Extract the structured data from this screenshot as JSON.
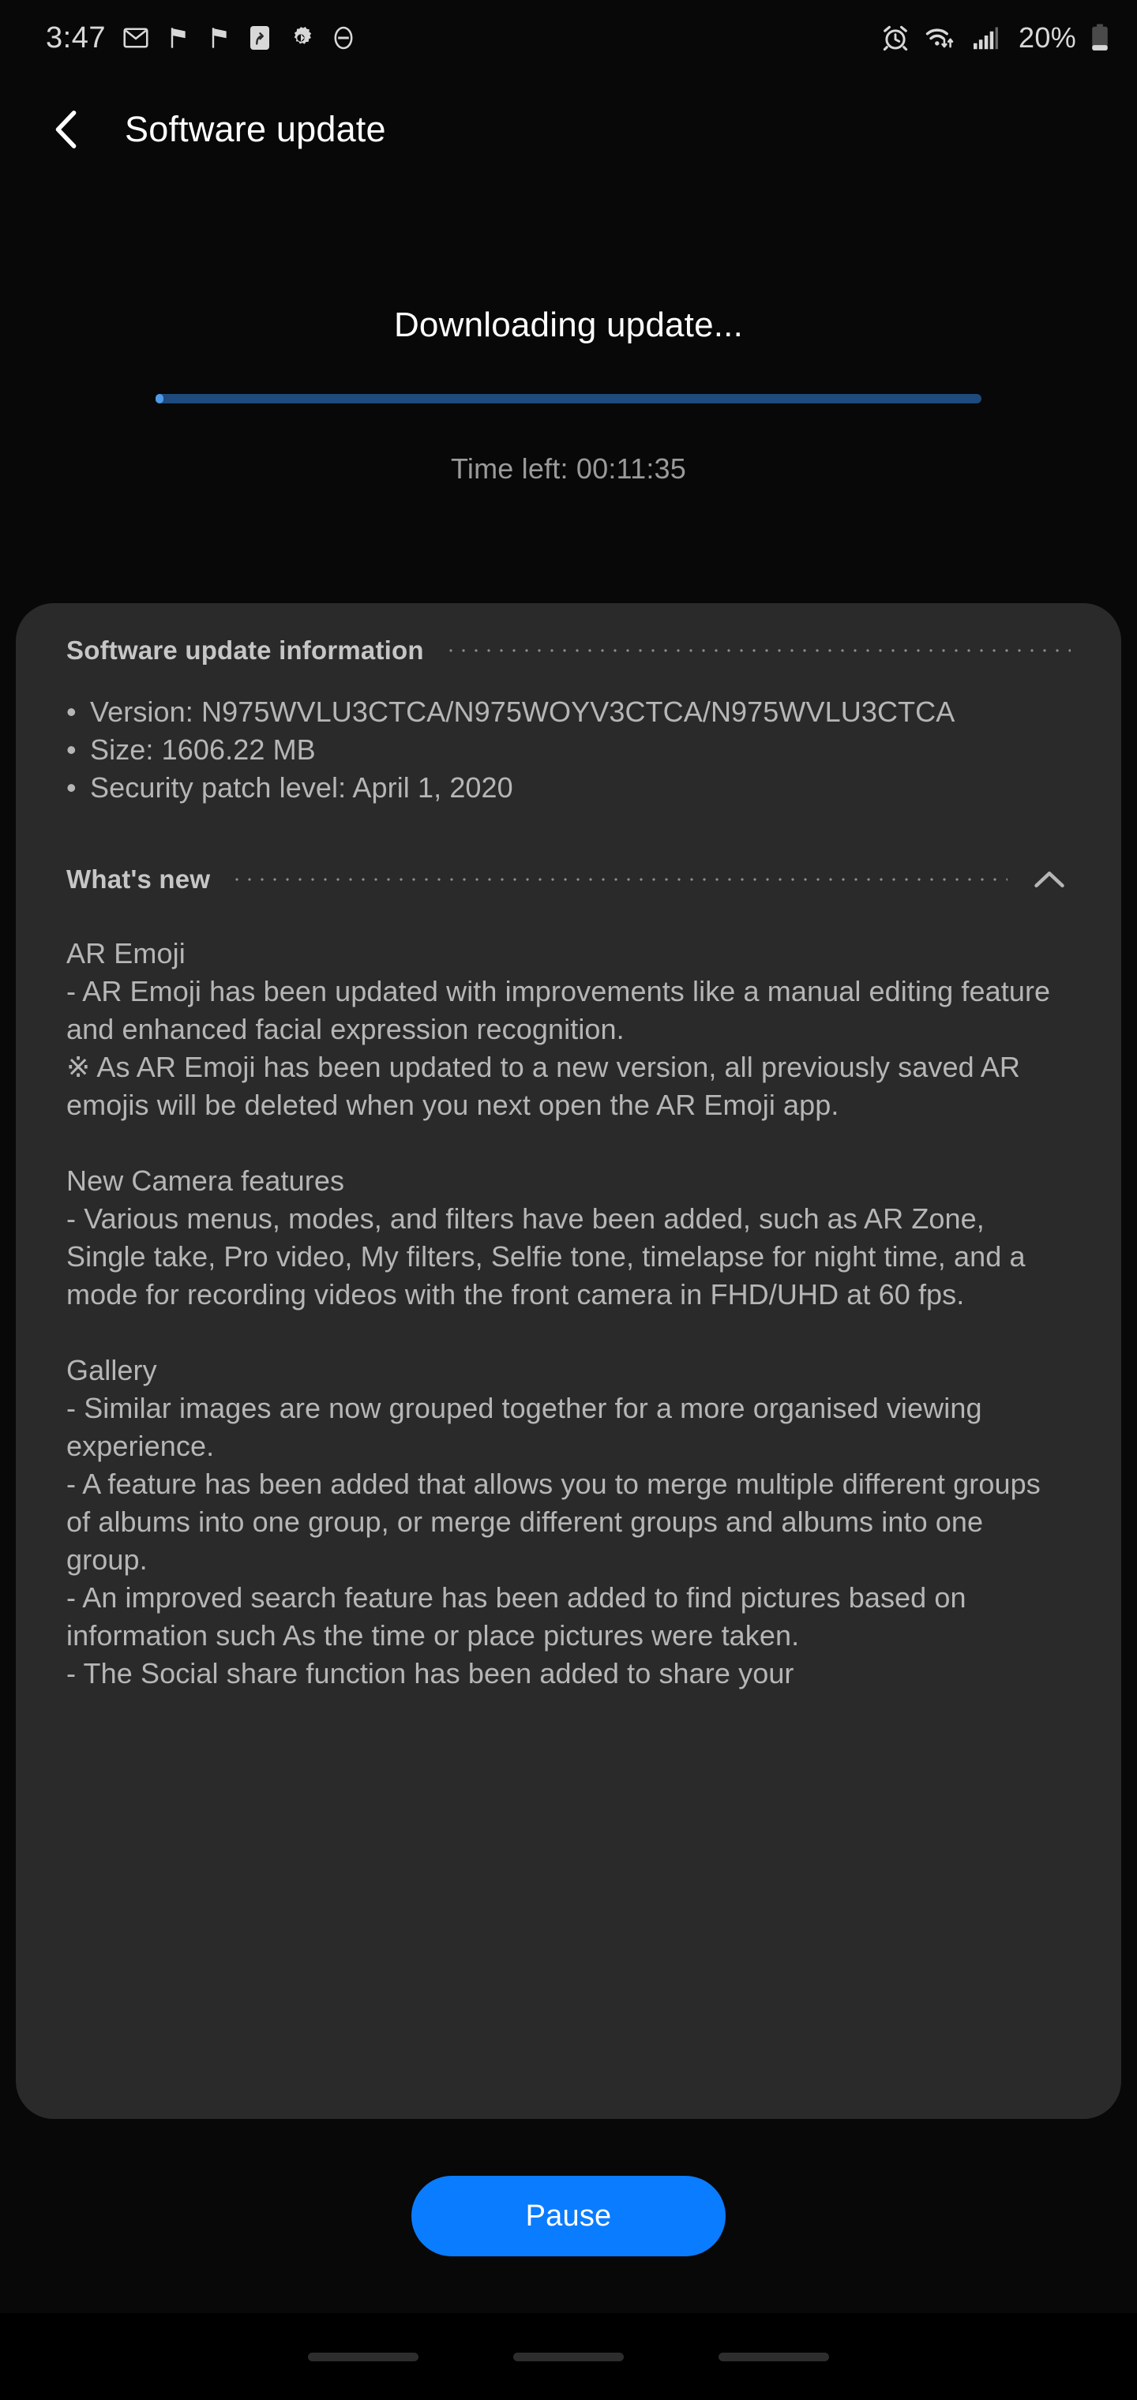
{
  "status_bar": {
    "time": "3:47",
    "battery_percent": "20%",
    "left_icons": [
      "gmail-icon",
      "flag-icon",
      "flag-icon",
      "app-shortcut-icon",
      "gear-icon",
      "do-not-disturb-icon"
    ],
    "right_icons": [
      "alarm-icon",
      "wifi-icon",
      "signal-icon",
      "battery-icon"
    ]
  },
  "header": {
    "title": "Software update",
    "back_icon": "chevron-left-icon"
  },
  "download": {
    "heading": "Downloading update...",
    "progress_percent": 1,
    "time_left": "Time left: 00:11:35",
    "track_color": "#1f4a7d",
    "fill_color": "#4f9ae8"
  },
  "info_section": {
    "title": "Software update information",
    "items": [
      "Version: N975WVLU3CTCA/N975WOYV3CTCA/N975WVLU3CTCA",
      "Size: 1606.22 MB",
      "Security patch level: April 1, 2020"
    ]
  },
  "whats_new": {
    "title": "What's new",
    "collapse_icon": "chevron-up-icon",
    "body": "AR Emoji\n- AR Emoji has been updated with improvements like a manual editing feature and enhanced facial expression recognition.\n※ As AR Emoji has been updated to a new version, all previously saved AR emojis will be deleted when you next open the AR Emoji app.\n\nNew Camera features\n- Various menus, modes, and filters have been added, such as AR Zone, Single take, Pro video, My filters, Selfie tone, timelapse for night time, and a mode for recording videos with the front camera in FHD/UHD at 60 fps.\n\nGallery\n- Similar images are now grouped together for a more organised viewing experience.\n- A feature has been added that allows you to merge multiple different groups of albums into one group, or merge different groups and albums into one group.\n- An improved search feature has been added to find pictures based on information such As the time or place pictures were taken.\n- The Social share function has been added to share your"
  },
  "footer": {
    "pause_label": "Pause",
    "accent_color": "#0a7cff"
  },
  "nav_bar": {
    "pills": [
      "recents-pill",
      "home-pill",
      "back-pill"
    ]
  }
}
